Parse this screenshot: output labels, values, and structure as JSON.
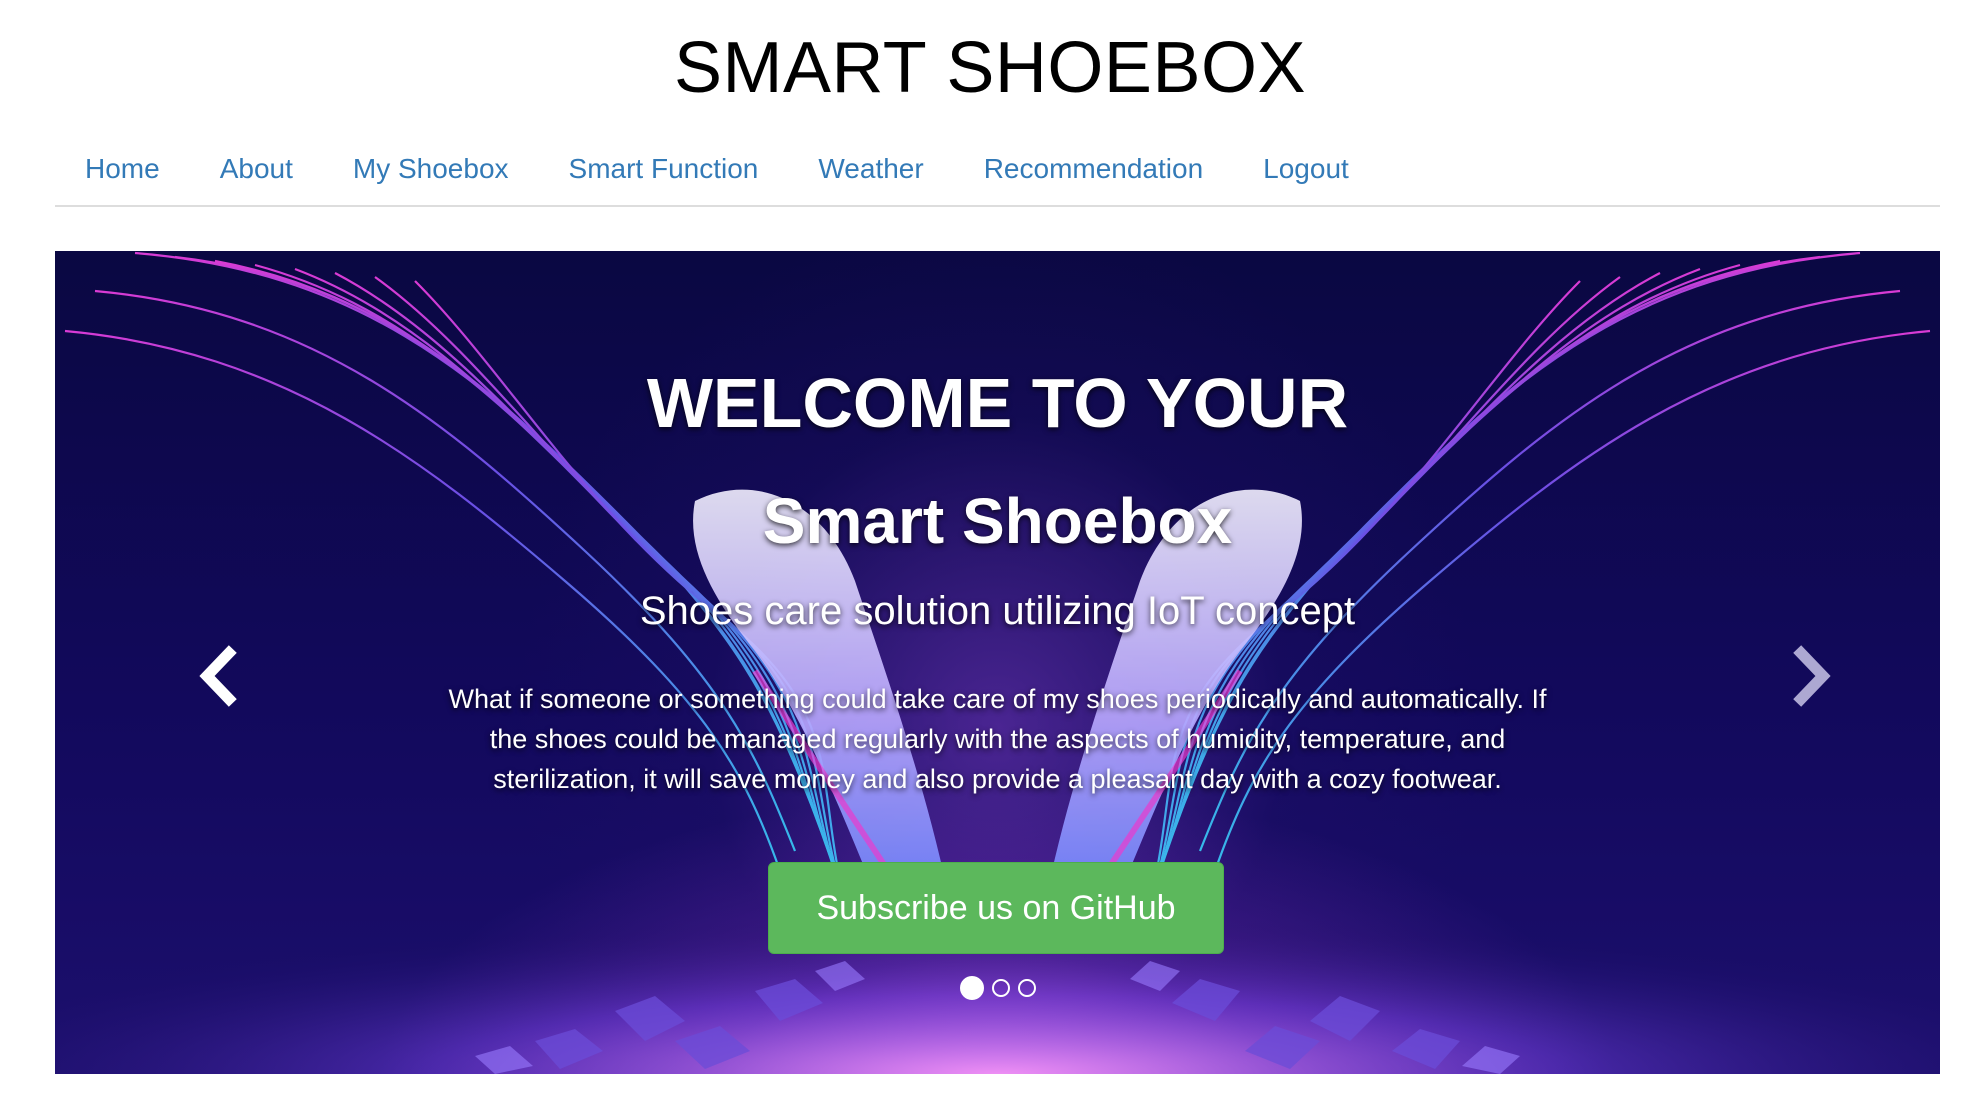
{
  "site": {
    "title": "SMART SHOEBOX"
  },
  "nav": {
    "items": [
      {
        "label": "Home"
      },
      {
        "label": "About"
      },
      {
        "label": "My Shoebox"
      },
      {
        "label": "Smart Function"
      },
      {
        "label": "Weather"
      },
      {
        "label": "Recommendation"
      },
      {
        "label": "Logout"
      }
    ],
    "link_color": "#337ab7"
  },
  "hero": {
    "heading": "WELCOME TO YOUR",
    "subheading": "Smart Shoebox",
    "tagline": "Shoes care solution utilizing IoT concept",
    "description": "What if someone or something could take care of my shoes periodically and automatically. If the shoes could be managed regularly with the aspects of humidity, temperature, and sterilization, it will save money and also provide a pleasant day with a cozy footwear.",
    "cta_label": "Subscribe us on GitHub",
    "cta_color": "#5cb85c",
    "controls": {
      "prev_icon": "chevron-left-icon",
      "next_icon": "chevron-right-icon"
    },
    "slides_total": 3,
    "active_slide": 1
  }
}
